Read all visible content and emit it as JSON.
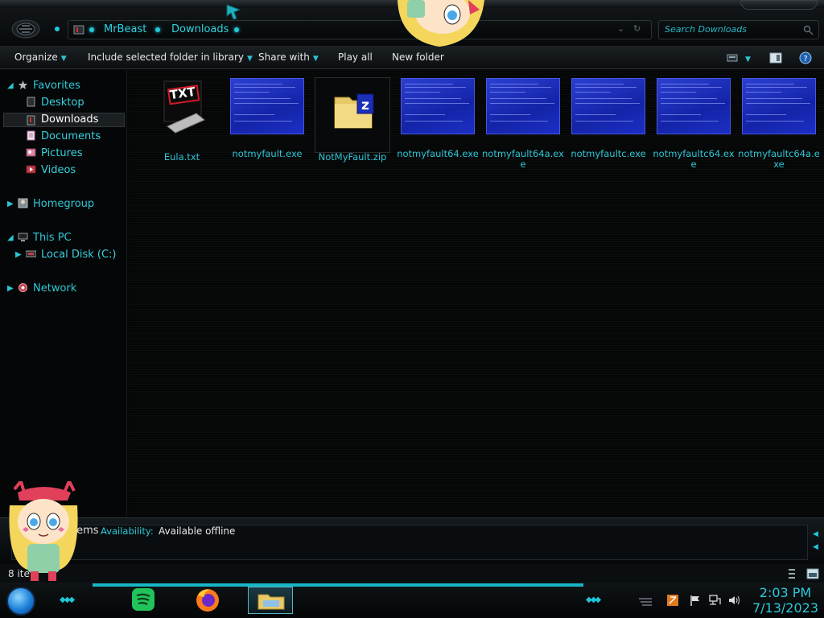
{
  "address_bar": {
    "crumbs": [
      "MrBeast",
      "Downloads"
    ]
  },
  "search": {
    "placeholder": "Search Downloads"
  },
  "toolbar": {
    "organize": "Organize",
    "include": "Include selected folder in library",
    "share": "Share with",
    "play_all": "Play all",
    "new_folder": "New folder"
  },
  "nav": {
    "favorites": "Favorites",
    "desktop": "Desktop",
    "downloads": "Downloads",
    "documents": "Documents",
    "pictures": "Pictures",
    "videos": "Videos",
    "homegroup": "Homegroup",
    "this_pc": "This PC",
    "local_disk": "Local Disk (C:)",
    "network": "Network"
  },
  "files": [
    {
      "name": "Eula.txt",
      "icon": "txt-file-icon"
    },
    {
      "name": "notmyfault.exe",
      "icon": "bsod-thumbnail"
    },
    {
      "name": "NotMyFault.zip",
      "icon": "zip-folder-icon"
    },
    {
      "name": "notmyfault64.exe",
      "icon": "bsod-thumbnail"
    },
    {
      "name": "notmyfault64a.exe",
      "icon": "bsod-thumbnail"
    },
    {
      "name": "notmyfaultc.exe",
      "icon": "bsod-thumbnail"
    },
    {
      "name": "notmyfaultc64.exe",
      "icon": "bsod-thumbnail"
    },
    {
      "name": "notmyfaultc64a.exe",
      "icon": "bsod-thumbnail"
    }
  ],
  "details": {
    "items_fragment": "tems",
    "availability_label": "Availability:",
    "availability_value": "Available offline"
  },
  "status": {
    "text": "8 ite"
  },
  "clock": {
    "time": "2:03 PM",
    "date": "7/13/2023"
  },
  "colors": {
    "accent": "#2ec9d8",
    "background": "#050607",
    "bsod_blue": "#1a2bb8"
  }
}
